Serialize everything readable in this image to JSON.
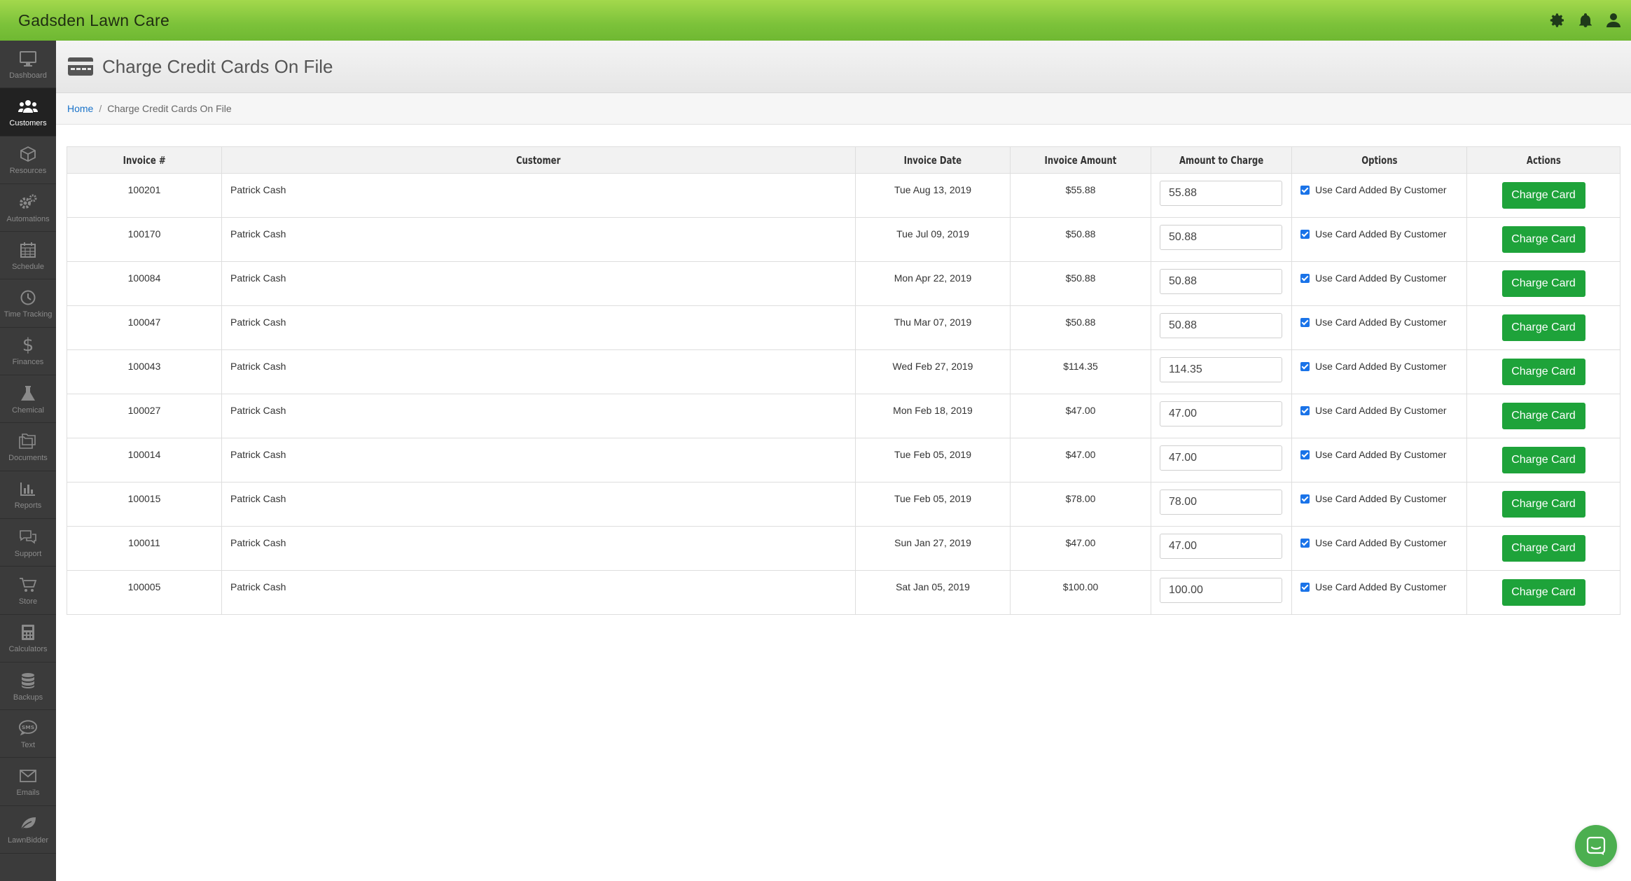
{
  "app": {
    "title": "Gadsden Lawn Care"
  },
  "topbar": {
    "icons": [
      "gear-icon",
      "bell-icon",
      "user-icon"
    ]
  },
  "sidebar": {
    "items": [
      {
        "label": "Dashboard",
        "icon": "monitor-icon",
        "active": false
      },
      {
        "label": "Customers",
        "icon": "users-icon",
        "active": true
      },
      {
        "label": "Resources",
        "icon": "box-icon",
        "active": false
      },
      {
        "label": "Automations",
        "icon": "gears-icon",
        "active": false
      },
      {
        "label": "Schedule",
        "icon": "calendar-icon",
        "active": false
      },
      {
        "label": "Time Tracking",
        "icon": "clock-icon",
        "active": false
      },
      {
        "label": "Finances",
        "icon": "dollar-icon",
        "active": false
      },
      {
        "label": "Chemical",
        "icon": "flask-icon",
        "active": false
      },
      {
        "label": "Documents",
        "icon": "folders-icon",
        "active": false
      },
      {
        "label": "Reports",
        "icon": "bar-chart-icon",
        "active": false
      },
      {
        "label": "Support",
        "icon": "chat-bubbles-icon",
        "active": false
      },
      {
        "label": "Store",
        "icon": "cart-icon",
        "active": false
      },
      {
        "label": "Calculators",
        "icon": "calculator-icon",
        "active": false
      },
      {
        "label": "Backups",
        "icon": "database-icon",
        "active": false
      },
      {
        "label": "Text",
        "icon": "sms-icon",
        "active": false
      },
      {
        "label": "Emails",
        "icon": "envelope-icon",
        "active": false
      },
      {
        "label": "LawnBidder",
        "icon": "leaf-icon",
        "active": false
      }
    ]
  },
  "page": {
    "title": "Charge Credit Cards On File"
  },
  "breadcrumb": {
    "home": "Home",
    "separator": "/",
    "current": "Charge Credit Cards On File"
  },
  "table": {
    "headers": [
      "Invoice #",
      "Customer",
      "Invoice Date",
      "Invoice Amount",
      "Amount to Charge",
      "Options",
      "Actions"
    ],
    "rows": [
      {
        "invoice": "100201",
        "customer": "Patrick Cash",
        "date": "Tue Aug 13, 2019",
        "amount": "$55.88",
        "charge": "55.88",
        "option": "Use Card Added By Customer",
        "action": "Charge Card"
      },
      {
        "invoice": "100170",
        "customer": "Patrick Cash",
        "date": "Tue Jul 09, 2019",
        "amount": "$50.88",
        "charge": "50.88",
        "option": "Use Card Added By Customer",
        "action": "Charge Card"
      },
      {
        "invoice": "100084",
        "customer": "Patrick Cash",
        "date": "Mon Apr 22, 2019",
        "amount": "$50.88",
        "charge": "50.88",
        "option": "Use Card Added By Customer",
        "action": "Charge Card"
      },
      {
        "invoice": "100047",
        "customer": "Patrick Cash",
        "date": "Thu Mar 07, 2019",
        "amount": "$50.88",
        "charge": "50.88",
        "option": "Use Card Added By Customer",
        "action": "Charge Card"
      },
      {
        "invoice": "100043",
        "customer": "Patrick Cash",
        "date": "Wed Feb 27, 2019",
        "amount": "$114.35",
        "charge": "114.35",
        "option": "Use Card Added By Customer",
        "action": "Charge Card"
      },
      {
        "invoice": "100027",
        "customer": "Patrick Cash",
        "date": "Mon Feb 18, 2019",
        "amount": "$47.00",
        "charge": "47.00",
        "option": "Use Card Added By Customer",
        "action": "Charge Card"
      },
      {
        "invoice": "100014",
        "customer": "Patrick Cash",
        "date": "Tue Feb 05, 2019",
        "amount": "$47.00",
        "charge": "47.00",
        "option": "Use Card Added By Customer",
        "action": "Charge Card"
      },
      {
        "invoice": "100015",
        "customer": "Patrick Cash",
        "date": "Tue Feb 05, 2019",
        "amount": "$78.00",
        "charge": "78.00",
        "option": "Use Card Added By Customer",
        "action": "Charge Card"
      },
      {
        "invoice": "100011",
        "customer": "Patrick Cash",
        "date": "Sun Jan 27, 2019",
        "amount": "$47.00",
        "charge": "47.00",
        "option": "Use Card Added By Customer",
        "action": "Charge Card"
      },
      {
        "invoice": "100005",
        "customer": "Patrick Cash",
        "date": "Sat Jan 05, 2019",
        "amount": "$100.00",
        "charge": "100.00",
        "option": "Use Card Added By Customer",
        "action": "Charge Card"
      }
    ]
  },
  "colors": {
    "topbar": "#7cc23a",
    "sidebar": "#3b3b3b",
    "button": "#1ea33a",
    "link": "#1a73c9",
    "chat": "#4caf50"
  }
}
